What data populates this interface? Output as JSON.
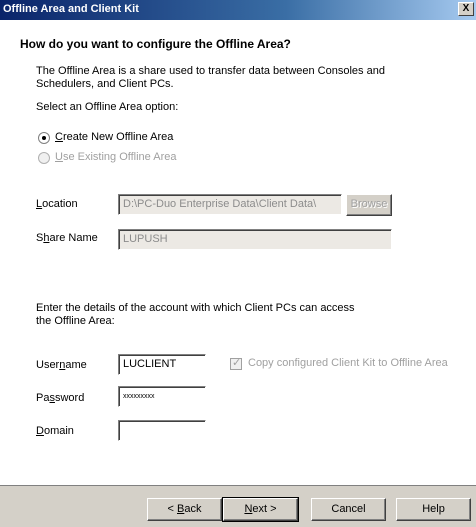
{
  "window": {
    "title": "Offline Area and Client Kit",
    "close_glyph": "X"
  },
  "page": {
    "heading": "How do you want to configure the Offline Area?",
    "intro_line1": "The Offline Area is a share used to transfer data between Consoles and",
    "intro_line2": "Schedulers, and Client PCs.",
    "select_prompt": "Select an Offline Area option:"
  },
  "options": {
    "create_new": {
      "accel": "C",
      "rest": "reate New Offline Area",
      "checked": true
    },
    "use_existing": {
      "accel": "U",
      "rest": "se Existing Offline Area",
      "enabled": false
    }
  },
  "location": {
    "label_accel": "L",
    "label_rest": "ocation",
    "value": "D:\\PC-Duo Enterprise Data\\Client Data\\",
    "browse_label": "Browse"
  },
  "share": {
    "label_pre": "S",
    "label_accel": "h",
    "label_rest": "are Name",
    "value": "LUPUSH"
  },
  "account": {
    "prompt_line1": "Enter the details of the account with which Client PCs can access",
    "prompt_line2": "the Offline Area:",
    "username_pre": "User",
    "username_accel": "n",
    "username_rest": "ame",
    "username_value": "LUCLIENT",
    "password_pre": "Pa",
    "password_accel": "s",
    "password_rest": "sword",
    "password_value": "xxxxxxxxx",
    "domain_accel": "D",
    "domain_rest": "omain",
    "domain_value": "",
    "copy_kit_label": "Copy configured Client Kit to Offline Area",
    "copy_kit_checked": true
  },
  "buttons": {
    "back_pre": "< ",
    "back_accel": "B",
    "back_rest": "ack",
    "next_accel": "N",
    "next_rest": "ext >",
    "cancel": "Cancel",
    "help": "Help"
  }
}
